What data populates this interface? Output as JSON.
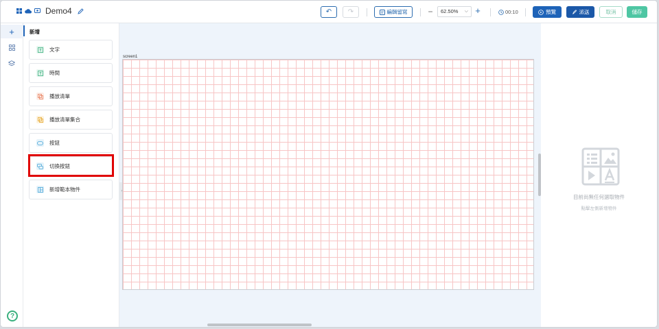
{
  "header": {
    "doc_title": "Demo4",
    "buttons": {
      "undo": "↶",
      "redo": "↷",
      "edit_comment": "編輯留寫",
      "preview": "預覽",
      "publish": "派送",
      "cancel": "取消",
      "save": "儲存"
    },
    "zoom": "62.50%",
    "timer": "00:10"
  },
  "panel": {
    "title": "新增",
    "items": [
      {
        "label": "文字",
        "icon": "text-icon",
        "color": "#3ab07e"
      },
      {
        "label": "時間",
        "icon": "time-icon",
        "color": "#3ab07e"
      },
      {
        "label": "播放清單",
        "icon": "playlist-icon",
        "color": "#e8805e"
      },
      {
        "label": "播放清單集合",
        "icon": "playlist-set-icon",
        "color": "#e5a72d"
      },
      {
        "label": "按鈕",
        "icon": "button-icon",
        "color": "#4aa6d8"
      },
      {
        "label": "切換按鈕",
        "icon": "toggle-button-icon",
        "color": "#4aa6d8"
      },
      {
        "label": "新增範本物件",
        "icon": "template-icon",
        "color": "#4aa6d8"
      }
    ]
  },
  "canvas": {
    "screen_label": "screen1"
  },
  "right_panel": {
    "empty_title": "目前尚無任何選取物件",
    "empty_sub": "點擊左側新增物件"
  }
}
